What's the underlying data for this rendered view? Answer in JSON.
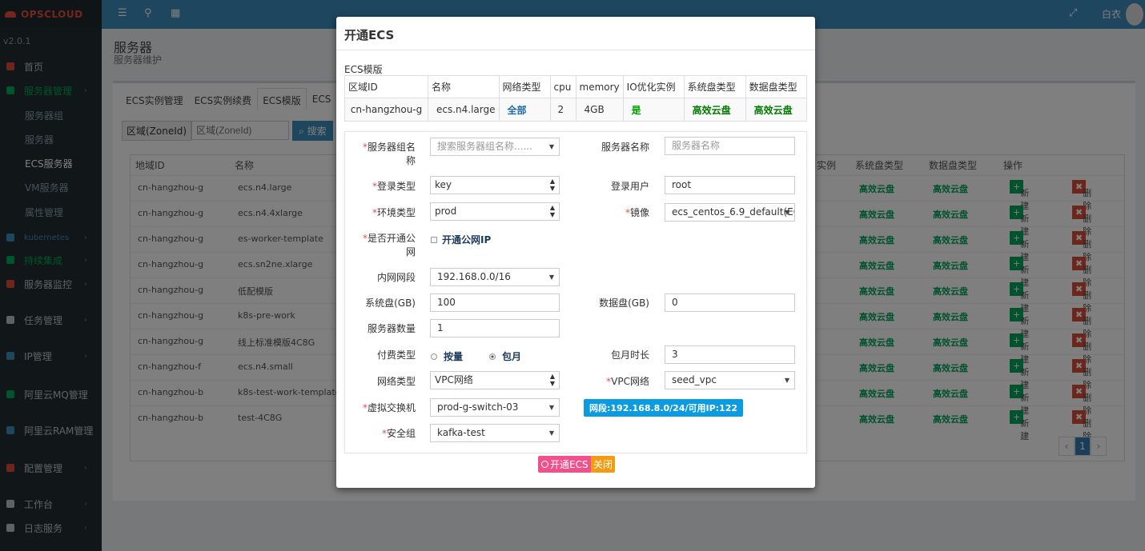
{
  "app": {
    "logo": "OPSCLOUD",
    "version": "v2.0.1",
    "user": "白衣"
  },
  "sidebar": [
    {
      "label": "首页",
      "color": "#dd4b39"
    },
    {
      "label": "服务器管理",
      "color": "#00a65a"
    },
    {
      "label": "kubernetes",
      "color": "#3c8dbc"
    },
    {
      "label": "持续集成",
      "color": "#00a65a"
    },
    {
      "label": "服务器监控",
      "color": "#dd4b39"
    },
    {
      "label": "任务管理",
      "color": "#b8c7ce"
    },
    {
      "label": "IP管理",
      "color": "#3c8dbc"
    },
    {
      "label": "阿里云MQ管理",
      "color": "#00a65a"
    },
    {
      "label": "阿里云RAM管理",
      "color": "#3c8dbc"
    },
    {
      "label": "配置管理",
      "color": "#dd4b39"
    },
    {
      "label": "工作台",
      "color": "#b8c7ce"
    },
    {
      "label": "日志服务",
      "color": "#b8c7ce"
    }
  ],
  "sidebar_sub": [
    "服务器组",
    "服务器",
    "ECS服务器",
    "VM服务器",
    "属性管理"
  ],
  "page": {
    "title": "服务器",
    "subtitle": "服务器维护"
  },
  "tabs": [
    "ECS实例管理",
    "ECS实例续费",
    "ECS模版",
    "ECS"
  ],
  "search": {
    "label": "区域(ZoneId)",
    "placeholder": "区域(ZoneId)",
    "button": "搜索"
  },
  "bg_table": {
    "headers": [
      "地域ID",
      "名称",
      "实例",
      "系统盘类型",
      "数据盘类型",
      "操作"
    ],
    "rows": [
      {
        "zone": "cn-hangzhou-g",
        "name": "ecs.n4.large"
      },
      {
        "zone": "cn-hangzhou-g",
        "name": "ecs.n4.4xlarge"
      },
      {
        "zone": "cn-hangzhou-g",
        "name": "es-worker-template"
      },
      {
        "zone": "cn-hangzhou-g",
        "name": "ecs.sn2ne.xlarge"
      },
      {
        "zone": "cn-hangzhou-g",
        "name": "低配模版"
      },
      {
        "zone": "cn-hangzhou-g",
        "name": "k8s-pre-work"
      },
      {
        "zone": "cn-hangzhou-g",
        "name": "线上标准模版4C8G"
      },
      {
        "zone": "cn-hangzhou-f",
        "name": "ecs.n4.small"
      },
      {
        "zone": "cn-hangzhou-b",
        "name": "k8s-test-work-template"
      },
      {
        "zone": "cn-hangzhou-b",
        "name": "test-4C8G"
      }
    ],
    "disk": "高效云盘",
    "new_label": "新建",
    "del_label": "删除",
    "page": "1"
  },
  "modal": {
    "title": "开通ECS",
    "template_label": "ECS模版",
    "template_headers": [
      "区域ID",
      "名称",
      "网络类型",
      "cpu",
      "memory",
      "IO优化实例",
      "系统盘类型",
      "数据盘类型"
    ],
    "template_row": [
      "cn-hangzhou-g",
      "ecs.n4.large",
      "全部",
      "2",
      "4GB",
      "是",
      "高效云盘",
      "高效云盘"
    ],
    "form": {
      "group_label_1": "服务器组名",
      "group_label_2": "称",
      "group_placeholder": "搜索服务器组名称......",
      "server_name_label": "服务器名称",
      "server_name_placeholder": "服务器名称",
      "login_type_label": "登录类型",
      "login_type_value": "key",
      "login_user_label": "登录用户",
      "login_user_value": "root",
      "env_label": "环境类型",
      "env_value": "prod",
      "image_label": "镜像",
      "image_value": "ecs_centos_6.9_default(EC",
      "public_ip_label_1": "是否开通公",
      "public_ip_label_2": "网",
      "public_ip_option": "开通公网IP",
      "subnet_label": "内网网段",
      "subnet_value": "192.168.0.0/16",
      "sys_disk_label": "系统盘(GB)",
      "sys_disk_value": "100",
      "data_disk_label": "数据盘(GB)",
      "data_disk_value": "0",
      "count_label": "服务器数量",
      "count_value": "1",
      "pay_label": "付费类型",
      "pay_opt1": "按量",
      "pay_opt2": "包月",
      "month_label": "包月时长",
      "month_value": "3",
      "net_type_label": "网络类型",
      "net_type_value": "VPC网络",
      "vpc_label": "VPC网络",
      "vpc_value": "seed_vpc",
      "vswitch_label": "虚拟交换机",
      "vswitch_value": "prod-g-switch-03",
      "vswitch_badge": "网段:192.168.8.0/24/可用IP:122",
      "sg_label": "安全组",
      "sg_value": "kafka-test"
    },
    "open_button": "开通ECS",
    "close_button": "关闭"
  }
}
